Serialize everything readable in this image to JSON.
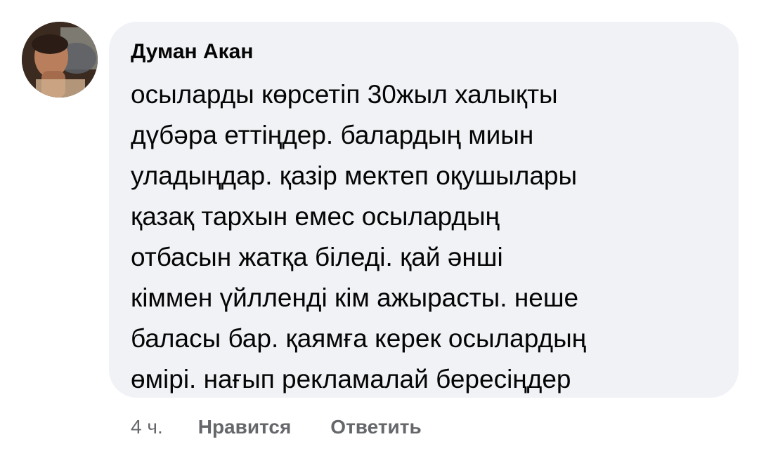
{
  "comment": {
    "author": "Думан Акан",
    "lines": [
      "осыларды көрсетіп 30жыл халықты",
      "дүбәра еттіңдер. балардың миын",
      "уладыңдар. қазір мектеп оқушылары",
      "қазақ тархын емес осылардың",
      "отбасын жатқа біледі. қай әнші",
      "кіммен үйлленді кім ажырасты. неше",
      "баласы бар. қаямға керек осылардың",
      "өмірі. нағып рекламалай бересіңдер"
    ],
    "time": "4 ч.",
    "like_label": "Нравится",
    "reply_label": "Ответить"
  },
  "colors": {
    "bubble_bg": "#f0f2f5",
    "text": "#050505",
    "secondary_text": "#65676b"
  },
  "icons": {
    "avatar": "user-avatar-photo"
  }
}
